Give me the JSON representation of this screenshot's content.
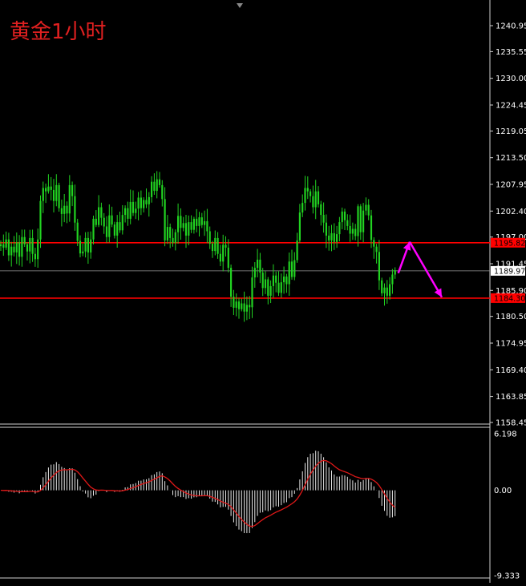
{
  "title": "黄金1小时",
  "chart_data": [
    {
      "type": "candlestick",
      "title": "黄金1小时",
      "ylim": [
        1155.9,
        1244.5
      ],
      "y_ticks": [
        "1240.95",
        "1235.55",
        "1230.00",
        "1224.45",
        "1219.05",
        "1213.50",
        "1207.95",
        "1202.40",
        "1197.00",
        "1191.45",
        "1185.90",
        "1180.50",
        "1174.95",
        "1169.40",
        "1163.85",
        "1158.45"
      ],
      "current_price": "1189.97",
      "horizontal_lines": [
        {
          "label": "1195.82",
          "value": 1195.82,
          "color": "#ff0000"
        },
        {
          "label": "1184.30",
          "value": 1184.3,
          "color": "#ff0000"
        }
      ],
      "arrows": [
        {
          "color": "#ff00ff",
          "from_price": 1189.5,
          "to_price": 1196.0
        },
        {
          "color": "#ff00ff",
          "from_price": 1196.0,
          "to_price": 1184.5
        }
      ],
      "closes": [
        1195.5,
        1194.8,
        1196.5,
        1193.2,
        1195.0,
        1193.8,
        1195.9,
        1192.9,
        1197.0,
        1195.5,
        1194.0,
        1196.8,
        1193.5,
        1192.4,
        1196.5,
        1204.5,
        1207.2,
        1206.5,
        1207.5,
        1206.8,
        1204.5,
        1207.8,
        1203.0,
        1201.8,
        1203.5,
        1201.9,
        1207.8,
        1205.5,
        1200.0,
        1196.2,
        1193.6,
        1194.0,
        1196.8,
        1193.8,
        1196.5,
        1200.8,
        1199.5,
        1203.2,
        1201.0,
        1199.2,
        1197.0,
        1201.5,
        1199.6,
        1197.3,
        1200.1,
        1198.4,
        1201.6,
        1203.0,
        1200.8,
        1204.3,
        1202.0,
        1202.9,
        1205.2,
        1203.0,
        1204.7,
        1203.8,
        1205.3,
        1208.5,
        1206.6,
        1209.0,
        1207.8,
        1204.9,
        1196.3,
        1199.1,
        1196.8,
        1195.8,
        1198.0,
        1201.4,
        1198.9,
        1199.9,
        1197.3,
        1200.1,
        1198.5,
        1200.8,
        1199.3,
        1201.1,
        1199.5,
        1200.3,
        1198.2,
        1195.6,
        1194.1,
        1196.8,
        1193.5,
        1191.9,
        1195.4,
        1194.8,
        1190.6,
        1184.6,
        1182.3,
        1183.6,
        1182.0,
        1183.2,
        1181.5,
        1182.9,
        1182.4,
        1188.6,
        1190.6,
        1192.3,
        1189.6,
        1186.4,
        1188.2,
        1184.8,
        1186.8,
        1189.0,
        1187.5,
        1185.4,
        1187.6,
        1188.8,
        1187.2,
        1191.9,
        1188.7,
        1192.2,
        1196.3,
        1202.1,
        1204.1,
        1207.2,
        1206.5,
        1205.5,
        1203.2,
        1206.5,
        1203.8,
        1201.6,
        1200.0,
        1197.3,
        1196.3,
        1197.8,
        1196.0,
        1197.6,
        1200.1,
        1202.3,
        1200.5,
        1199.3,
        1197.7,
        1198.7,
        1197.2,
        1203.4,
        1198.0,
        1202.5,
        1203.7,
        1201.5,
        1196.4,
        1195.0,
        1193.9,
        1188.0,
        1185.3,
        1186.5,
        1184.8,
        1187.2,
        1189.2,
        1190.1
      ],
      "macd": {
        "ylim": [
          -9.333,
          6.198
        ],
        "y_ticks": [
          "6.198",
          "0.00",
          "-9.333"
        ]
      }
    }
  ]
}
